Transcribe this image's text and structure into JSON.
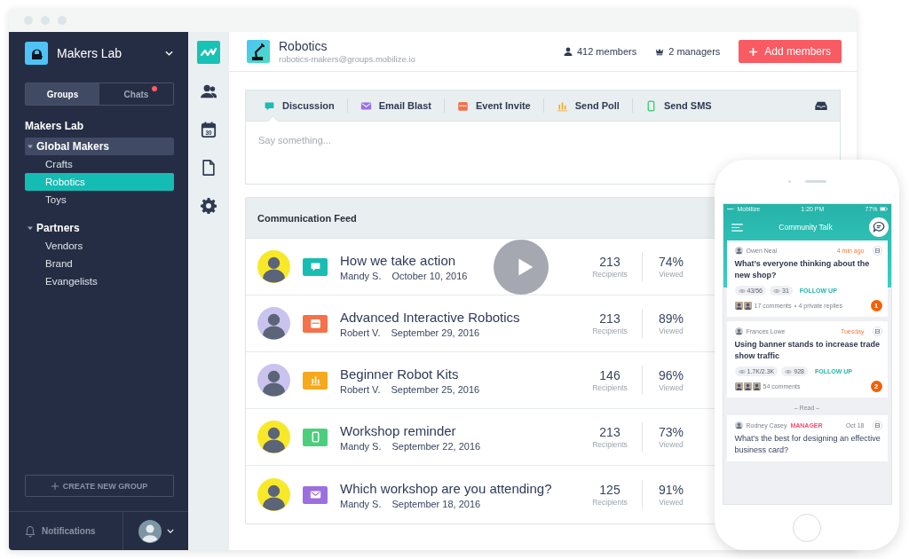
{
  "sidebar": {
    "org": "Makers Lab",
    "segments": [
      {
        "label": "Groups",
        "selected": true,
        "unread": false
      },
      {
        "label": "Chats",
        "selected": false,
        "unread": true
      }
    ],
    "heading": "Makers Lab",
    "groups": [
      {
        "label": "Global Makers",
        "expanded": true,
        "active": true,
        "children": [
          {
            "label": "Crafts",
            "selected": false
          },
          {
            "label": "Robotics",
            "selected": true
          },
          {
            "label": "Toys",
            "selected": false
          }
        ]
      },
      {
        "label": "Partners",
        "expanded": true,
        "active": false,
        "children": [
          {
            "label": "Vendors",
            "selected": false
          },
          {
            "label": "Brand",
            "selected": false
          },
          {
            "label": "Evangelists",
            "selected": false
          }
        ]
      }
    ],
    "create_button": "CREATE NEW GROUP",
    "notifications": "Notifications"
  },
  "rail": {
    "items": [
      {
        "kind": "logo"
      },
      {
        "kind": "people"
      },
      {
        "kind": "calendar",
        "day": "30"
      },
      {
        "kind": "document"
      },
      {
        "kind": "settings"
      }
    ]
  },
  "group": {
    "name": "Robotics",
    "email": "robotics-makers@groups.mobilize.io",
    "members": "412 members",
    "managers": "2 managers",
    "add_button": "Add members"
  },
  "composer": {
    "tabs": [
      {
        "label": "Discussion",
        "kind": "discussion",
        "selected": true
      },
      {
        "label": "Email Blast",
        "kind": "email",
        "selected": false
      },
      {
        "label": "Event Invite",
        "kind": "event",
        "selected": false
      },
      {
        "label": "Send Poll",
        "kind": "poll",
        "selected": false
      },
      {
        "label": "Send SMS",
        "kind": "sms",
        "selected": false
      }
    ],
    "placeholder": "Say something..."
  },
  "feed": {
    "title": "Communication Feed",
    "rows": [
      {
        "title": "How we take action",
        "author": "Mandy S.",
        "date": "October 10, 2016",
        "kind": "discussion",
        "color": "#f7e928",
        "recipients": "213",
        "recipients_label": "Recipients",
        "viewed": "74%",
        "viewed_label": "Viewed"
      },
      {
        "title": "Advanced Interactive Robotics",
        "author": "Robert V.",
        "date": "September 29, 2016",
        "kind": "event",
        "color": "#c9c3ee",
        "recipients": "213",
        "recipients_label": "Recipients",
        "viewed": "89%",
        "viewed_label": "Viewed"
      },
      {
        "title": "Beginner Robot Kits",
        "author": "Robert V.",
        "date": "September 25, 2016",
        "kind": "poll",
        "color": "#c9c3ee",
        "recipients": "146",
        "recipients_label": "Recipients",
        "viewed": "96%",
        "viewed_label": "Viewed"
      },
      {
        "title": "Workshop reminder",
        "author": "Mandy S.",
        "date": "September 22, 2016",
        "kind": "sms",
        "color": "#f7e928",
        "recipients": "213",
        "recipients_label": "Recipients",
        "viewed": "73%",
        "viewed_label": "Viewed"
      },
      {
        "title": "Which workshop are you attending?",
        "author": "Mandy S.",
        "date": "September 18, 2016",
        "kind": "email",
        "color": "#f7e928",
        "recipients": "125",
        "recipients_label": "Recipients",
        "viewed": "91%",
        "viewed_label": "Viewed"
      }
    ]
  },
  "phone": {
    "carrier": "Mobilize",
    "time": "1:20 PM",
    "battery": "77%",
    "title": "Community Talk",
    "cards": [
      {
        "author": "Owen Neal",
        "when": "4 min ago",
        "unread": true,
        "title": "What’s everyone thinking about the new shop?",
        "stats": [
          "43/56",
          "31"
        ],
        "action": "FOLLOW UP",
        "comments": "17 comments",
        "replies": "4 private replies",
        "badge": "1"
      },
      {
        "author": "Frances Lowe",
        "when": "Tuesday",
        "unread": true,
        "title": "Using banner stands to increase trade show traffic",
        "stats": [
          "1.7K/2.3K",
          "928"
        ],
        "action": "FOLLOW UP",
        "comments": "54 comments",
        "badge": "2"
      }
    ],
    "read_label": "– Read –",
    "read_cards": [
      {
        "author": "Rodney Casey",
        "role": "MANAGER",
        "when": "Oct 18",
        "unread": false,
        "title": "What’s the best for designing an effective business card?"
      }
    ]
  }
}
